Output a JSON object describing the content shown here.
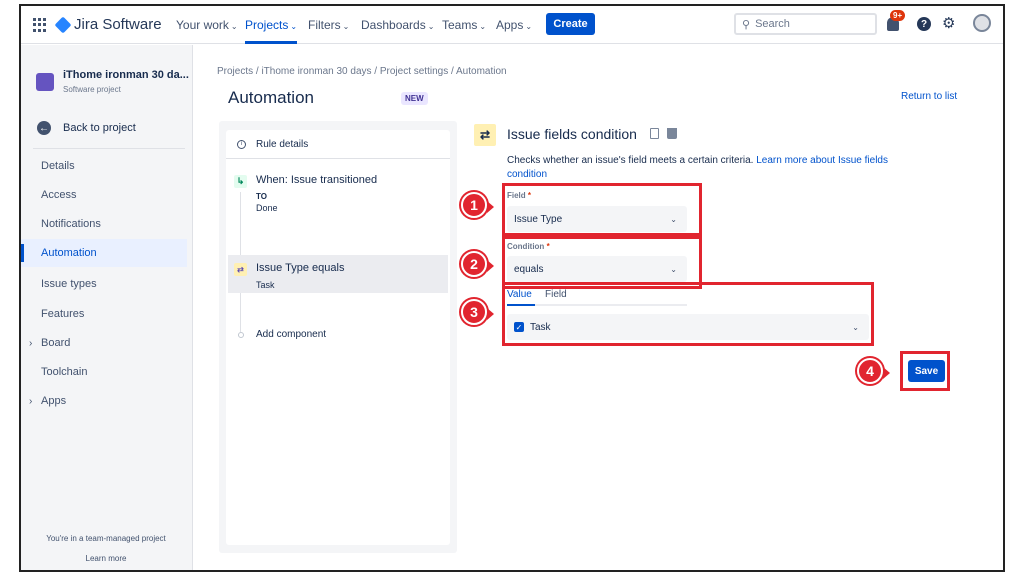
{
  "topnav": {
    "brand": "Jira Software",
    "items": [
      {
        "label": "Your work",
        "active": false
      },
      {
        "label": "Projects",
        "active": true
      },
      {
        "label": "Filters",
        "active": false
      },
      {
        "label": "Dashboards",
        "active": false
      },
      {
        "label": "Teams",
        "active": false
      },
      {
        "label": "Apps",
        "active": false
      }
    ],
    "create_label": "Create",
    "search_placeholder": "Search",
    "notification_count": "9+",
    "help_label": "?"
  },
  "sidebar": {
    "project_name": "iThome ironman 30 da...",
    "project_type": "Software project",
    "back_label": "Back to project",
    "items": [
      {
        "label": "Details"
      },
      {
        "label": "Access"
      },
      {
        "label": "Notifications"
      },
      {
        "label": "Automation"
      },
      {
        "label": "Issue types"
      },
      {
        "label": "Features"
      },
      {
        "label": "Board"
      },
      {
        "label": "Toolchain"
      },
      {
        "label": "Apps"
      }
    ],
    "team_note": "You're in a team-managed project",
    "learn_more": "Learn more"
  },
  "main": {
    "breadcrumb": "Projects  /  iThome ironman 30 days  /  Project settings  /  Automation",
    "title": "Automation",
    "new_tag": "NEW",
    "return_link": "Return to list"
  },
  "rule": {
    "details_label": "Rule details",
    "trigger_title": "When: Issue transitioned",
    "trigger_to": "TO",
    "trigger_status": "Done",
    "condition_title": "Issue Type equals",
    "condition_value": "Task",
    "add_component": "Add component"
  },
  "condition_editor": {
    "title": "Issue fields condition",
    "description": "Checks whether an issue's field meets a certain criteria. ",
    "learn_more": "Learn more about Issue fields condition",
    "field_label": "Field",
    "field_value": "Issue Type",
    "condition_label": "Condition",
    "condition_value": "equals",
    "tab_value": "Value",
    "tab_field": "Field",
    "value_selected": "Task",
    "required_mark": "*",
    "save_label": "Save"
  },
  "annotations": {
    "n1": "1",
    "n2": "2",
    "n3": "3",
    "n4": "4"
  },
  "colors": {
    "accent": "#0052cc",
    "annotation_red": "#e1252f"
  }
}
